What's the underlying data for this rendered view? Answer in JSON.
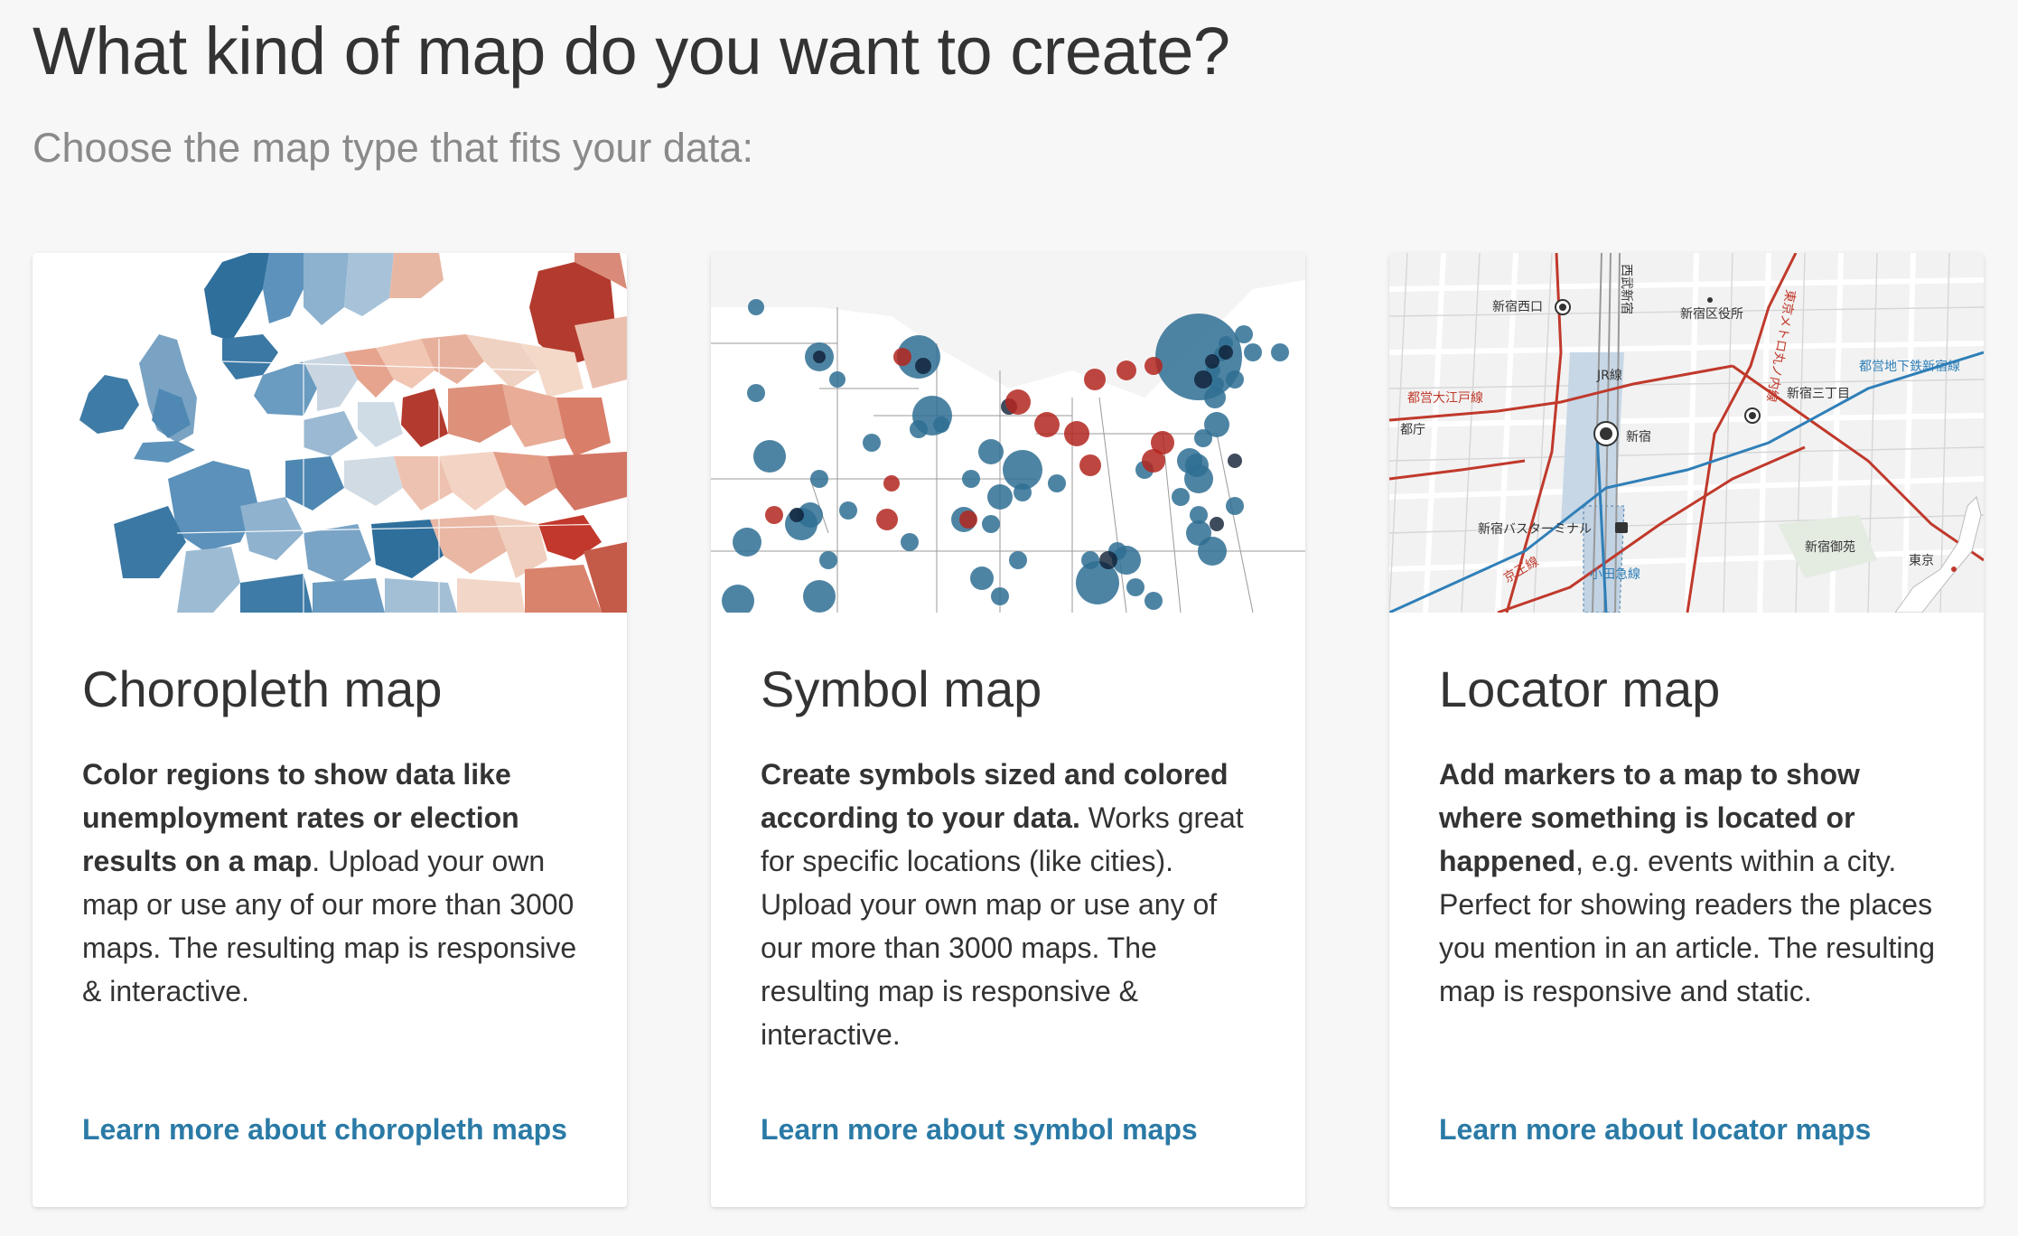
{
  "header": {
    "title": "What kind of map do you want to create?",
    "subtitle": "Choose the map type that fits your data:"
  },
  "colors": {
    "background": "#f7f7f7",
    "card_background": "#ffffff",
    "link": "#2a7aa6",
    "choropleth_blue": "#3d7ba4",
    "choropleth_red": "#b33a2e",
    "symbol_blue": "#2f6f93",
    "symbol_red": "#b3261e"
  },
  "cards": [
    {
      "title": "Choropleth map",
      "desc_bold": "Color regions to show data like unemployment rates or election results on a map",
      "desc_rest": ". Upload your own map or use any of our more than 3000 maps. The resulting map is responsive & interactive.",
      "link": "Learn more about choropleth maps",
      "thumbnail": "choropleth-europe-thumbnail"
    },
    {
      "title": "Symbol map",
      "desc_bold": "Create symbols sized and colored according to your data.",
      "desc_rest": " Works great for specific locations (like cities). Upload your own map or use any of our more than 3000 maps. The resulting map is responsive & interactive.",
      "link": "Learn more about symbol maps",
      "thumbnail": "symbol-map-usa-thumbnail"
    },
    {
      "title": "Locator map",
      "desc_bold": "Add markers to a map to show where something is located or happened",
      "desc_rest": ", e.g. events within a city. Perfect for showing readers the places you mention in an article. The resulting map is responsive and static.",
      "link": "Learn more about locator maps",
      "thumbnail": "locator-map-shinjuku-thumbnail",
      "map_labels": {
        "station": "新宿",
        "shinjuku_nishiguchi": "新宿西口",
        "seibu_shinjuku": "西武新宿",
        "ward_office": "新宿区役所",
        "marunouchi_line": "東京メトロ丸ノ内線",
        "oedo_line": "都営大江戸線",
        "jr_line": "JR線",
        "shinjuku_sanchome": "新宿三丁目",
        "shinjuku_line": "都営地下鉄新宿線",
        "tocho": "都庁",
        "bus_terminal": "新宿バスターミナル",
        "keio_line": "京王線",
        "odakyu_line": "小田急線",
        "gyoen": "新宿御苑",
        "tokyo": "東京"
      }
    }
  ]
}
